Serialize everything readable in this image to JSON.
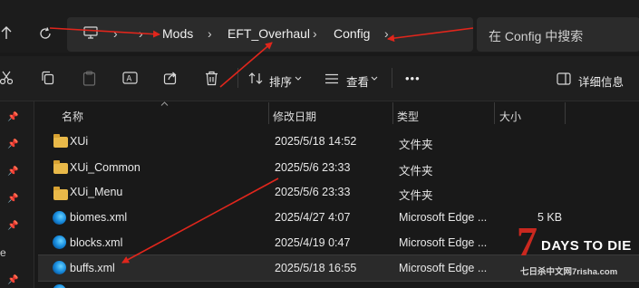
{
  "address_bar": {
    "breadcrumbs": [
      "Mods",
      "EFT_Overhaul",
      "Config"
    ],
    "search_placeholder": "在 Config 中搜索"
  },
  "command_bar": {
    "sort_label": "排序",
    "view_label": "查看",
    "more_label": "•••",
    "details_label": "详细信息"
  },
  "columns": {
    "name": "名称",
    "modified": "修改日期",
    "type": "类型",
    "size": "大小"
  },
  "files": [
    {
      "name": "XUi",
      "modified": "2025/5/18 14:52",
      "type": "文件夹",
      "size": "",
      "icon": "folder-icon"
    },
    {
      "name": "XUi_Common",
      "modified": "2025/5/6 23:33",
      "type": "文件夹",
      "size": "",
      "icon": "folder-icon"
    },
    {
      "name": "XUi_Menu",
      "modified": "2025/5/6 23:33",
      "type": "文件夹",
      "size": "",
      "icon": "folder-icon"
    },
    {
      "name": "biomes.xml",
      "modified": "2025/4/27 4:07",
      "type": "Microsoft Edge ...",
      "size": "5 KB",
      "icon": "edge-icon"
    },
    {
      "name": "blocks.xml",
      "modified": "2025/4/19 0:47",
      "type": "Microsoft Edge ...",
      "size": "",
      "icon": "edge-icon"
    },
    {
      "name": "buffs.xml",
      "modified": "2025/5/18 16:55",
      "type": "Microsoft Edge ...",
      "size": "",
      "icon": "edge-icon",
      "selected": true
    }
  ],
  "nav_strip": {
    "edge_char": "e"
  },
  "watermark": {
    "seven": "7",
    "title": "DAYS TO DIE",
    "subtitle": "七日杀中文网7risha.com"
  },
  "colors": {
    "annotation_arrow": "#e0261c",
    "folder": "#e9b949",
    "background": "#191919"
  }
}
